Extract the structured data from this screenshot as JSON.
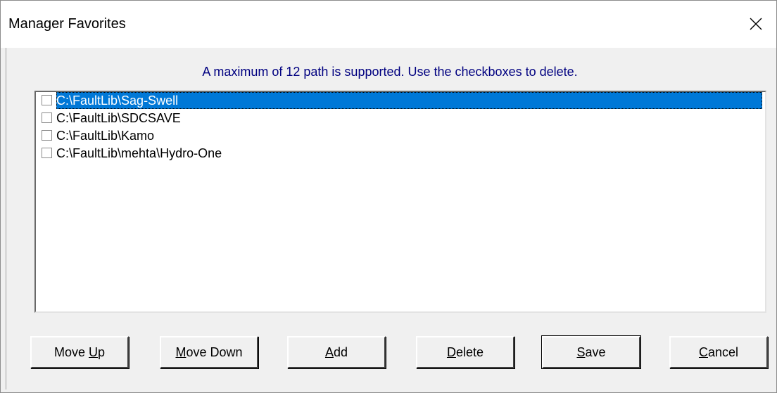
{
  "window": {
    "title": "Manager Favorites",
    "close_glyph": "close-icon"
  },
  "instruction": "A maximum of 12 path is supported. Use the checkboxes to delete.",
  "favorites": [
    {
      "path": "C:\\FaultLib\\Sag-Swell",
      "checked": false,
      "selected": true
    },
    {
      "path": "C:\\FaultLib\\SDCSAVE",
      "checked": false,
      "selected": false
    },
    {
      "path": "C:\\FaultLib\\Kamo",
      "checked": false,
      "selected": false
    },
    {
      "path": "C:\\FaultLib\\mehta\\Hydro-One",
      "checked": false,
      "selected": false
    }
  ],
  "buttons": {
    "move_up": {
      "pre": "Move ",
      "key": "U",
      "post": "p"
    },
    "move_down": {
      "pre": "",
      "key": "M",
      "post": "ove Down"
    },
    "add": {
      "pre": "",
      "key": "A",
      "post": "dd"
    },
    "delete": {
      "pre": "",
      "key": "D",
      "post": "elete"
    },
    "save": {
      "pre": "",
      "key": "S",
      "post": "ave"
    },
    "cancel": {
      "pre": "",
      "key": "C",
      "post": "ancel"
    }
  },
  "colors": {
    "selection": "#0078d7",
    "instruction_text": "#000080"
  }
}
